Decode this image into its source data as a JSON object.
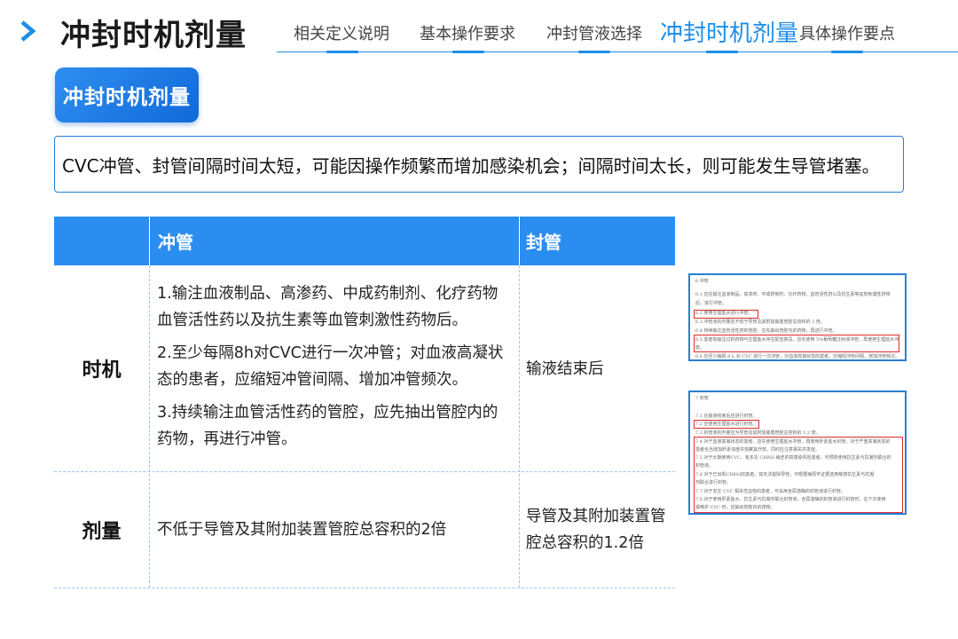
{
  "header": {
    "title": "冲封时机剂量",
    "tabs": [
      {
        "label": "相关定义说明",
        "active": false
      },
      {
        "label": "基本操作要求",
        "active": false
      },
      {
        "label": "冲封管液选择",
        "active": false
      },
      {
        "label": "冲封时机剂量",
        "active": true
      },
      {
        "label": "具体操作要点",
        "active": false
      }
    ],
    "accent_color": "#1f8ee8"
  },
  "section": {
    "badge": "冲封时机剂量",
    "description": "CVC冲管、封管间隔时间太短，可能因操作频繁而增加感染机会；间隔时间太长，则可能发生导管堵塞。"
  },
  "table": {
    "headers": [
      "",
      "冲管",
      "封管"
    ],
    "rows": [
      {
        "label": "时机",
        "flush": [
          "1.输注血液制品、高渗药、中成药制剂、化疗药物血管活性药以及抗生素等血管刺激性药物后。",
          "2.至少每隔8h对CVC进行一次冲管；对血液高凝状态的患者，应缩短冲管间隔、增加冲管频次。",
          "3.持续输注血管活性药的管腔，应先抽出管腔内的药物，再进行冲管。"
        ],
        "lock": "输液结束后"
      },
      {
        "label": "剂量",
        "flush": [
          "不低于导管及其附加装置管腔总容积的2倍"
        ],
        "lock": "导管及其附加装置管腔总容积的1.2倍"
      }
    ],
    "header_color": "#2a8def"
  },
  "documents": {
    "flush": {
      "lines": [
        "6  冲管",
        "6.1  应在输注血液制品、高渗药、中成药制剂、化疗药物、血管活性药以及抗生素等血管刺激性药物",
        "后，进行冲管。",
        "6.2  使用生理盐水进行冲管。",
        "6.3  冲管液的剂量应不低于导管及其附加装置管腔总容积的 2 倍。",
        "6.4  持续输注血管活性药的管腔，应先抽出管腔内的药物，再进行冲管。",
        "6.5  患者有输注过的药物与生理盐水存在配伍禁忌，应先使用 5%葡萄糖注射液冲管，再使用生理盐水冲",
        "管。",
        "6.6  应至少每隔 8 h 对 CVC 进行一次冲管，对血液高凝状态的患者，应缩短冲管间隔、增加冲管频次。"
      ]
    },
    "lock": {
      "lines": [
        "7  封管",
        "7.1  在输液结束后应进行封管。",
        "7.2  应使用生理盐水进行封管。",
        "7.3  封管液的剂量应为导管及其附加装置管腔总容积的 1.2 倍。",
        "7.4  对于血液高凝状态的患者，应先使用生理盐水冲管，再使用肝素盐水封管。对于严重高凝状态的",
        "患者也当增加肝素浓度并观察其疗效，同时应注意相关并发症。",
        "7.5  对于长期使用CVC、有多次 CRBSI 病史的高感染风险患者，可预防使用抗生素与抗凝剂联合的",
        "封管液。",
        "7.6  对于已出现CRBSI的患者，如无法拔除导管，可根据病原学证据选用敏感抗生素与抗凝",
        "剂联合进行封管。",
        "7.7  对于发生 CVC 相关性血栓的患者，可采用含尿激酶的封管液进行封管。",
        "7.8  对于使用肝素盐水、抗生素与抗凝剂联合封管液，含尿激酶的封管液进行封管时，在下次使用",
        "或维护 CVC 时，应抽出管腔内的药物。"
      ]
    }
  }
}
